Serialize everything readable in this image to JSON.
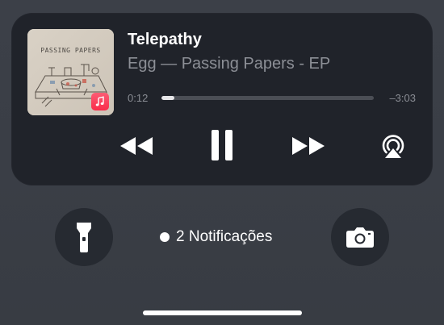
{
  "now_playing": {
    "title": "Telepathy",
    "subtitle": "Egg — Passing Papers - EP",
    "artwork_text": "PASSING PAPERS",
    "elapsed": "0:12",
    "remaining": "–3:03",
    "progress_fraction": 0.062,
    "badge_icon": "apple-music-icon"
  },
  "controls": {
    "rewind_icon": "rewind-icon",
    "pause_icon": "pause-icon",
    "forward_icon": "fast-forward-icon",
    "airplay_icon": "airplay-audio-icon"
  },
  "lockscreen": {
    "flashlight_icon": "flashlight-icon",
    "camera_icon": "camera-icon",
    "notifications_label": "2 Notificações"
  },
  "colors": {
    "background": "#3a3e46",
    "player_card": "#20232a",
    "secondary_text": "#8c8f96",
    "music_badge": "#fa2c4a"
  }
}
